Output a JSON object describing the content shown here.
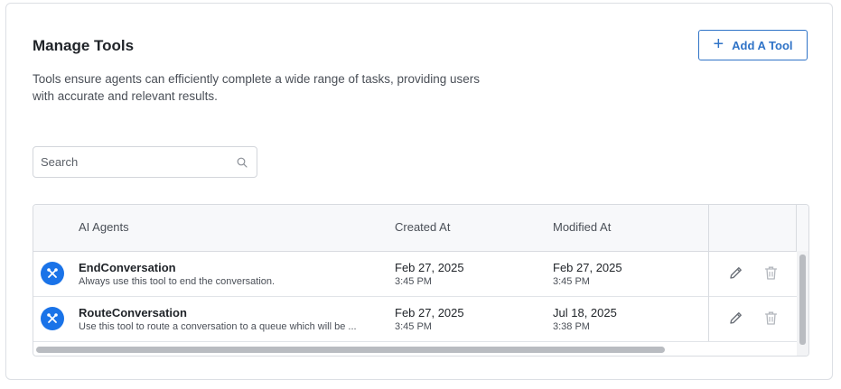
{
  "header": {
    "title": "Manage Tools",
    "description": "Tools ensure agents can efficiently complete a wide range of tasks, providing users with accurate and relevant results.",
    "add_button_label": "Add A Tool"
  },
  "search": {
    "placeholder": "Search",
    "value": ""
  },
  "table": {
    "columns": [
      "AI Agents",
      "Created At",
      "Modified At"
    ],
    "rows": [
      {
        "name": "EndConversation",
        "description": "Always use this tool to end the conversation.",
        "created_date": "Feb 27, 2025",
        "created_time": "3:45 PM",
        "modified_date": "Feb 27, 2025",
        "modified_time": "3:45 PM"
      },
      {
        "name": "RouteConversation",
        "description": "Use this tool to route a conversation to a queue which will be ...",
        "created_date": "Feb 27, 2025",
        "created_time": "3:45 PM",
        "modified_date": "Jul 18, 2025",
        "modified_time": "3:38 PM"
      }
    ]
  },
  "icons": {
    "tool": "tools-icon",
    "edit": "pencil-icon",
    "delete": "trash-icon",
    "search": "search-icon",
    "add": "plus-icon"
  },
  "colors": {
    "accent": "#1a73e8",
    "button_border": "#2f73c7"
  }
}
